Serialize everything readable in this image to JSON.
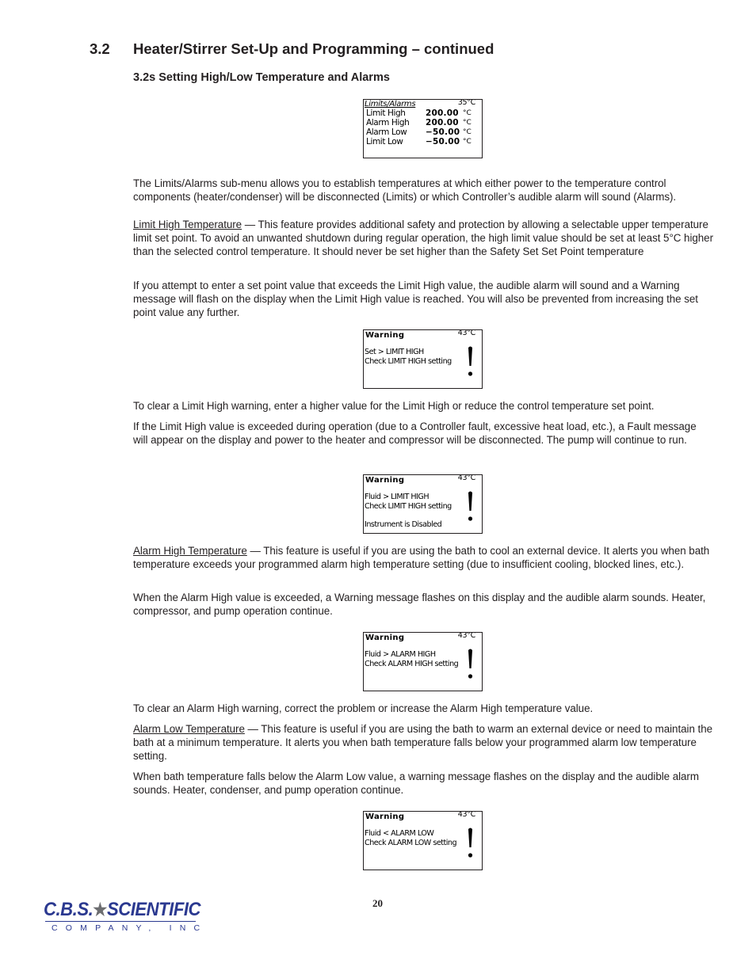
{
  "section": {
    "number": "3.2",
    "title": "Heater/Stirrer Set-Up and Programming – continued"
  },
  "subsection": {
    "title": "3.2s Setting High/Low Temperature and Alarms"
  },
  "displays": {
    "limits": {
      "title": "Limits/Alarms",
      "temp": "35°C",
      "rows": [
        {
          "label": "Limit High",
          "value": "200.00",
          "unit": "°C"
        },
        {
          "label": "Alarm High",
          "value": "200.00",
          "unit": "°C"
        },
        {
          "label": "Alarm Low",
          "value": "−50.00",
          "unit": "°C"
        },
        {
          "label": "Limit Low",
          "value": "−50.00",
          "unit": "°C"
        }
      ]
    },
    "warn_set_limit_high": {
      "title": "Warning",
      "temp": "43°C",
      "line1": "Set > LIMIT HIGH",
      "line2": "Check LIMIT HIGH setting",
      "icon": "exclamation-icon"
    },
    "warn_fluid_limit_high": {
      "title": "Warning",
      "temp": "43°C",
      "line1": "Fluid > LIMIT HIGH",
      "line2": "Check LIMIT HIGH setting",
      "line3": "Instrument is Disabled",
      "icon": "exclamation-icon"
    },
    "warn_fluid_alarm_high": {
      "title": "Warning",
      "temp": "43°C",
      "line1": "Fluid > ALARM HIGH",
      "line2": "Check ALARM HIGH setting",
      "icon": "exclamation-icon"
    },
    "warn_fluid_alarm_low": {
      "title": "Warning",
      "temp": "43°C",
      "line1": "Fluid < ALARM LOW",
      "line2": "Check ALARM LOW setting",
      "icon": "exclamation-icon"
    }
  },
  "paragraphs": {
    "intro": "The Limits/Alarms sub-menu allows you to establish temperatures at which either power to the temperature control components (heater/condenser) will be disconnected (Limits) or which Controller’s audible alarm will sound (Alarms).",
    "limit_high_term": "Limit High Temperature",
    "limit_high_body": " — This feature provides additional safety and protection by allowing a selectable upper temperature limit set point. To avoid an unwanted shutdown during regular operation, the high limit value should be set at least 5°C higher than the selected control temperature. It should never be set higher than the Safety Set Set Point temperature",
    "limit_high_attempt": "If you attempt to enter a set point value that exceeds the Limit High value, the audible alarm will sound and a Warning message will flash on the display when the Limit High value is reached. You will also be prevented from increasing the set point value any further.",
    "limit_high_clear": "To clear a Limit High warning, enter a higher value for the Limit High or reduce the control temperature set point.",
    "limit_high_exceeded": "If the Limit High value is exceeded during operation (due to a Controller fault, excessive heat load, etc.), a Fault message will appear on the display and power to the heater and compressor will be disconnected.  The pump will continue to run.",
    "alarm_high_term": "Alarm High Temperature",
    "alarm_high_body": " — This feature is useful if you are using the bath to cool an external device. It alerts you when bath temperature exceeds your programmed alarm high temperature setting (due to insufficient cooling, blocked lines, etc.).",
    "alarm_high_exceeded": "When the Alarm High value is exceeded, a Warning message flashes on this display and the audible alarm sounds. Heater, compressor, and pump operation continue.",
    "alarm_high_clear": "To clear an Alarm High warning, correct the problem or increase the Alarm High temperature value.",
    "alarm_low_term": "Alarm Low Temperature",
    "alarm_low_body": " — This feature is useful if you are using the bath to warm an external device or need to maintain the bath at a minimum temperature. It alerts you when bath temperature falls below your programmed alarm low temperature setting.",
    "alarm_low_below": "When bath temperature falls below the Alarm Low value, a warning message flashes on the display and the audible alarm sounds. Heater, condenser, and pump operation continue."
  },
  "footer": {
    "page_number": "20",
    "logo_brand_left": "C.B.S.",
    "logo_star": "★",
    "logo_brand_right": "SCIENTIFIC",
    "logo_sub": "COMPANY, INC",
    "brand_color": "#2b3990"
  }
}
